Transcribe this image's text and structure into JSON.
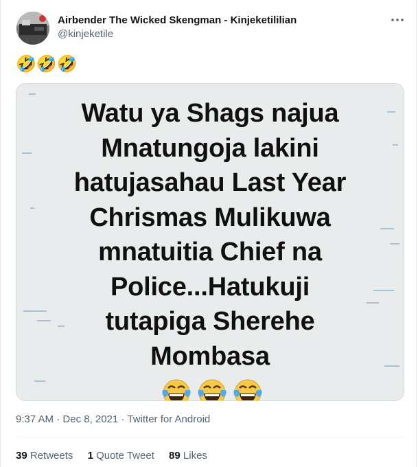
{
  "user": {
    "display_name": "Airbender The Wicked Skengman - Kinjeketililian",
    "handle": "@kinjeketile"
  },
  "more_icon": "more-horizontal-icon",
  "tweet_text": "🤣🤣🤣",
  "media": {
    "text": "Watu ya Shags najua\nMnatungoja lakini\nhatujasahau Last Year\nChrismas Mulikuwa\nmnatuitia Chief na\nPolice...Hatukuji\ntutapiga Sherehe\nMombasa",
    "emoji": [
      "😂",
      "😂",
      "😂"
    ]
  },
  "meta": {
    "time": "9:37 AM",
    "date": "Dec 8, 2021",
    "source": "Twitter for Android",
    "separator": "·"
  },
  "stats": {
    "retweets_count": "39",
    "retweets_label": "Retweets",
    "quotes_count": "1",
    "quotes_label": "Quote Tweet",
    "likes_count": "89",
    "likes_label": "Likes"
  },
  "colors": {
    "secondary_text": "#536471",
    "primary_text": "#0f1419",
    "media_background": "#e9ecec"
  }
}
